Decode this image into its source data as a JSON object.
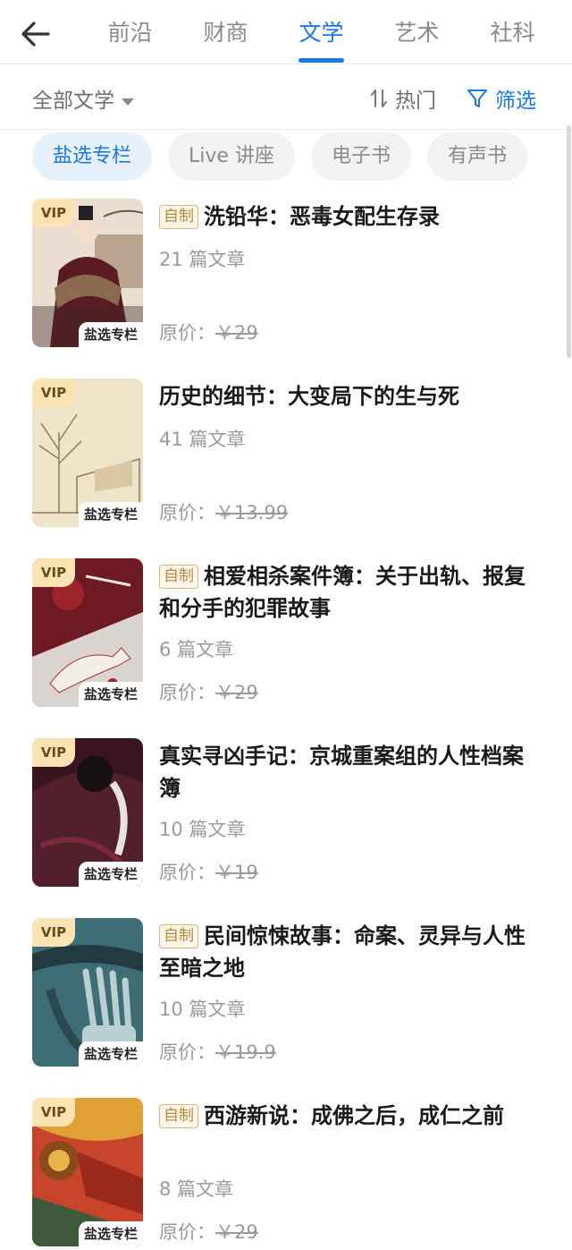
{
  "tabs": [
    {
      "label": "前沿"
    },
    {
      "label": "财商"
    },
    {
      "label": "文学"
    },
    {
      "label": "艺术"
    },
    {
      "label": "社科"
    }
  ],
  "active_tab": "文学",
  "filter_bar": {
    "category": "全部文学",
    "sort": "热门",
    "filter": "筛选"
  },
  "chips": [
    {
      "label": "盐选专栏"
    },
    {
      "label": "Live 讲座"
    },
    {
      "label": "电子书"
    },
    {
      "label": "有声书"
    }
  ],
  "items": [
    {
      "vip": "VIP",
      "badge": "盐选专栏",
      "self_tag": "自制",
      "title": "洗铅华：恶毒女配生存录",
      "count": "21 篇文章",
      "price_label": "原价：",
      "price": "￥29"
    },
    {
      "vip": "VIP",
      "badge": "盐选专栏",
      "self_tag": "",
      "title": "历史的细节：大变局下的生与死",
      "count": "41 篇文章",
      "price_label": "原价：",
      "price": "￥13.99"
    },
    {
      "vip": "VIP",
      "badge": "盐选专栏",
      "self_tag": "自制",
      "title": "相爱相杀案件簿：关于出轨、报复和分手的犯罪故事",
      "count": "6 篇文章",
      "price_label": "原价：",
      "price": "￥29"
    },
    {
      "vip": "VIP",
      "badge": "盐选专栏",
      "self_tag": "",
      "title": "真实寻凶手记：京城重案组的人性档案簿",
      "count": "10 篇文章",
      "price_label": "原价：",
      "price": "￥19"
    },
    {
      "vip": "VIP",
      "badge": "盐选专栏",
      "self_tag": "自制",
      "title": "民间惊悚故事：命案、灵异与人性至暗之地",
      "count": "10 篇文章",
      "price_label": "原价：",
      "price": "￥19.9"
    },
    {
      "vip": "VIP",
      "badge": "盐选专栏",
      "self_tag": "自制",
      "title": "西游新说：成佛之后，成仁之前",
      "count": "8 篇文章",
      "price_label": "原价：",
      "price": "￥29"
    }
  ],
  "icons": {
    "back": "back-arrow-icon",
    "caret": "caret-down-icon",
    "sort": "sort-icon",
    "filter": "funnel-filter-icon"
  },
  "colors": {
    "accent": "#1a79e6",
    "vip_bg": "#fbe3b3",
    "self_tag": "#b68a3c"
  }
}
